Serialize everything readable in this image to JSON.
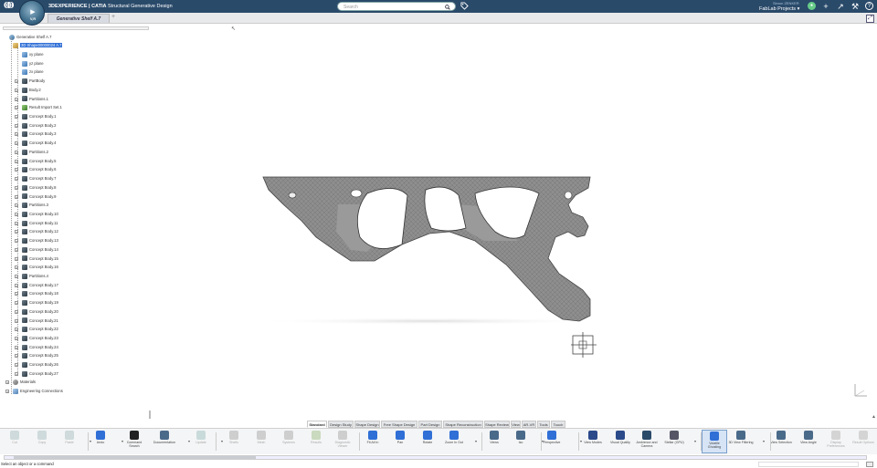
{
  "topbar": {
    "app_brand_bold": "3DEXPERIENCE | CATIA",
    "app_brand_rest": " Structural Generative Design",
    "search_placeholder": "Search",
    "user_name": "Simon ZENKER",
    "project_label": "FabLab Projects ▾",
    "compass_version": "V,R",
    "colors": {
      "bar": "#2a4a6a",
      "accent": "#2f6fd6"
    }
  },
  "tabs": {
    "document_tab": "Generative Shelf A.7",
    "add_tab": "+"
  },
  "tree": {
    "root": "Generative Shelf A.7",
    "selected": "3D Shape00000024 A.7",
    "items": [
      "xy plane",
      "yz plane",
      "zx plane",
      "PartBody",
      "Body.2",
      "Partitions.1",
      "Result Import Set.1",
      "Concept Body.1",
      "Concept Body.2",
      "Concept Body.3",
      "Concept Body.4",
      "Partitions.2",
      "Concept Body.5",
      "Concept Body.6",
      "Concept Body.7",
      "Concept Body.8",
      "Concept Body.9",
      "Partitions.3",
      "Concept Body.10",
      "Concept Body.11",
      "Concept Body.12",
      "Concept Body.13",
      "Concept Body.14",
      "Concept Body.15",
      "Concept Body.16",
      "Partitions.4",
      "Concept Body.17",
      "Concept Body.18",
      "Concept Body.19",
      "Concept Body.20",
      "Concept Body.21",
      "Concept Body.22",
      "Concept Body.23",
      "Concept Body.24",
      "Concept Body.25",
      "Concept Body.26",
      "Concept Body.27"
    ],
    "materials": "Materials",
    "engineering": "Engineering Connections"
  },
  "app_tabs": [
    "Standard",
    "Design Study",
    "Shape Design",
    "Free Shape Design",
    "Part Design",
    "Shape Reconstruction",
    "Shape Review",
    "View",
    "AR-VR",
    "Tools",
    "Touch"
  ],
  "active_app_tab": "Standard",
  "actions": [
    {
      "label": "Cut",
      "icon": "scissors-icon",
      "dim": true
    },
    {
      "label": "Copy",
      "icon": "copy-icon",
      "dim": true
    },
    {
      "label": "Paste",
      "icon": "paste-icon",
      "dim": true
    },
    {
      "label": "Undo",
      "icon": "undo-icon",
      "dim": false
    },
    {
      "label": "Command Search",
      "icon": "command-search-icon",
      "dim": false
    },
    {
      "label": "Documentation",
      "icon": "book-icon",
      "dim": false
    },
    {
      "label": "Update",
      "icon": "update-icon",
      "dim": true
    },
    {
      "label": "Shells",
      "icon": "shells-icon",
      "dim": true
    },
    {
      "label": "Mesh",
      "icon": "mesh-icon",
      "dim": true
    },
    {
      "label": "Systems",
      "icon": "systems-icon",
      "dim": true
    },
    {
      "label": "Results",
      "icon": "results-icon",
      "dim": true
    },
    {
      "label": "Diagnostic Viewer",
      "icon": "diagnostic-icon",
      "dim": true
    },
    {
      "label": "Fit All In",
      "icon": "fit-all-icon",
      "dim": false
    },
    {
      "label": "Pan",
      "icon": "pan-icon",
      "dim": false
    },
    {
      "label": "Rotate",
      "icon": "rotate-icon",
      "dim": false
    },
    {
      "label": "Zoom In Out",
      "icon": "zoom-icon",
      "dim": false
    },
    {
      "label": "Views",
      "icon": "views-icon",
      "dim": false
    },
    {
      "label": "Iso",
      "icon": "iso-icon",
      "dim": false
    },
    {
      "label": "Perspective",
      "icon": "perspective-icon",
      "dim": false
    },
    {
      "label": "View Modes",
      "icon": "view-modes-icon",
      "dim": false
    },
    {
      "label": "Visual Quality",
      "icon": "visual-quality-icon",
      "dim": false
    },
    {
      "label": "Ambience and Camera",
      "icon": "ambience-icon",
      "dim": false
    },
    {
      "label": "Stellar (GPU)",
      "icon": "stellar-icon",
      "dim": false
    },
    {
      "label": "Volatile Ghosting",
      "icon": "ghosting-icon",
      "dim": false,
      "on": true
    },
    {
      "label": "3D View Filtering",
      "icon": "filter-icon",
      "dim": false
    },
    {
      "label": "View Selection",
      "icon": "view-selection-icon",
      "dim": false
    },
    {
      "label": "View Angle",
      "icon": "view-angle-icon",
      "dim": false
    },
    {
      "label": "Display Preferences",
      "icon": "display-pref-icon",
      "dim": true
    },
    {
      "label": "Result Options",
      "icon": "result-options-icon",
      "dim": true
    }
  ],
  "status": {
    "message": "Select an object or a command"
  }
}
